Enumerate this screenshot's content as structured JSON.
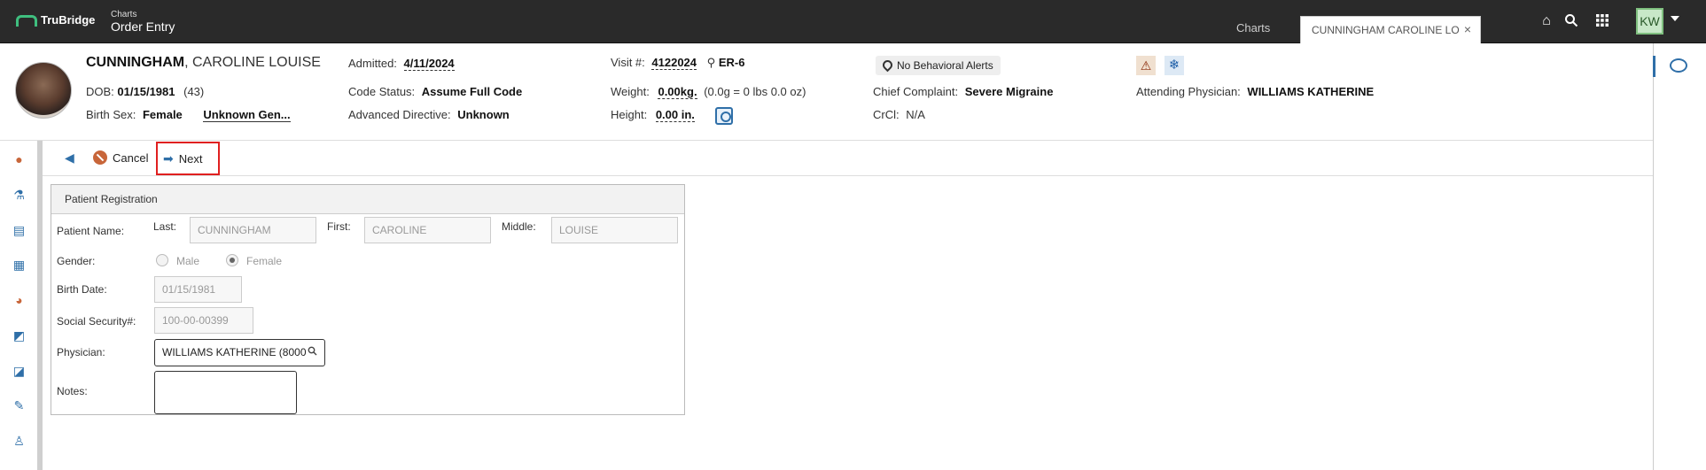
{
  "topbar": {
    "logo_text": "TruBridge",
    "app_small": "Charts",
    "app_title": "Order Entry",
    "tab_charts": "Charts",
    "tab_patient": "CUNNINGHAM CAROLINE LO",
    "tab_close": "×",
    "user_initials": "KW",
    "icons": [
      "home-icon",
      "search-icon",
      "apps-grid-icon"
    ]
  },
  "patient": {
    "last_name": "CUNNINGHAM",
    "rest_name": ", CAROLINE LOUISE",
    "dob_label": "DOB:",
    "dob": "01/15/1981",
    "age": "(43)",
    "sex_label": "Birth Sex:",
    "sex": "Female",
    "gender": "Unknown Gen...",
    "admitted_label": "Admitted:",
    "admitted": "4/11/2024",
    "code_label": "Code Status:",
    "code": "Assume Full Code",
    "adv_label": "Advanced Directive:",
    "adv": "Unknown",
    "visit_label": "Visit #:",
    "visit": "4122024",
    "location": "ER-6",
    "weight_label": "Weight:",
    "weight": "0.00kg.",
    "weight_conv": "(0.0g = 0 lbs 0.0 oz)",
    "height_label": "Height:",
    "height": "0.00 in.",
    "alerts": "No Behavioral Alerts",
    "complaint_label": "Chief Complaint:",
    "complaint": "Severe Migraine",
    "crcl_label": "CrCl:",
    "crcl": "N/A",
    "attending_label": "Attending Physician:",
    "attending": "WILLIAMS KATHERINE"
  },
  "toolbar": {
    "cancel_label": "Cancel",
    "next_label": "Next"
  },
  "registration": {
    "title": "Patient Registration",
    "patient_name_label": "Patient Name:",
    "last_label": "Last:",
    "last_value": "CUNNINGHAM",
    "first_label": "First:",
    "first_value": "CAROLINE",
    "middle_label": "Middle:",
    "middle_value": "LOUISE",
    "gender_label": "Gender:",
    "gender_options": [
      "Male",
      "Female"
    ],
    "gender_selected": "Female",
    "birth_date_label": "Birth Date:",
    "birth_date": "01/15/1981",
    "ssn_label": "Social Security#:",
    "ssn": "100-00-00399",
    "physician_label": "Physician:",
    "physician": "WILLIAMS KATHERINE (8000",
    "notes_label": "Notes:",
    "notes": ""
  },
  "colors": {
    "topbar": "#2a2a2a",
    "accent": "#2f6fa8",
    "highlight": "#e02020",
    "logo": "#3fbf7f"
  }
}
